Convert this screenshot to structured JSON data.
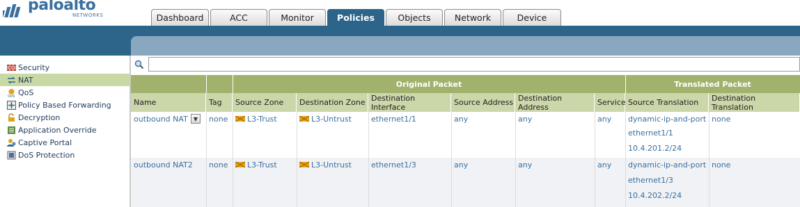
{
  "logo": {
    "name": "paloalto",
    "sub": "NETWORKS"
  },
  "tabs": [
    "Dashboard",
    "ACC",
    "Monitor",
    "Policies",
    "Objects",
    "Network",
    "Device"
  ],
  "active_tab": "Policies",
  "sidebar": {
    "items": [
      {
        "label": "Security",
        "icon": "firewall-icon"
      },
      {
        "label": "NAT",
        "icon": "nat-icon"
      },
      {
        "label": "QoS",
        "icon": "qos-icon"
      },
      {
        "label": "Policy Based Forwarding",
        "icon": "pbf-icon"
      },
      {
        "label": "Decryption",
        "icon": "lock-icon"
      },
      {
        "label": "Application Override",
        "icon": "app-override-icon"
      },
      {
        "label": "Captive Portal",
        "icon": "captive-portal-icon"
      },
      {
        "label": "DoS Protection",
        "icon": "dos-icon"
      }
    ],
    "active": "NAT"
  },
  "search": {
    "value": "",
    "placeholder": ""
  },
  "table": {
    "groups": {
      "original": "Original Packet",
      "translated": "Translated Packet"
    },
    "columns": [
      "Name",
      "Tag",
      "Source Zone",
      "Destination Zone",
      "Destination Interface",
      "Source Address",
      "Destination Address",
      "Service",
      "Source Translation",
      "Destination Translation"
    ],
    "rows": [
      {
        "name": "outbound NAT",
        "tag": "none",
        "source_zone": "L3-Trust",
        "destination_zone": "L3-Untrust",
        "destination_interface": "ethernet1/1",
        "source_address": "any",
        "destination_address": "any",
        "service": "any",
        "source_translation": [
          "dynamic-ip-and-port",
          "ethernet1/1",
          "10.4.201.2/24"
        ],
        "destination_translation": "none"
      },
      {
        "name": "outbound NAT2",
        "tag": "none",
        "source_zone": "L3-Trust",
        "destination_zone": "L3-Untrust",
        "destination_interface": "ethernet1/3",
        "source_address": "any",
        "destination_address": "any",
        "service": "any",
        "source_translation": [
          "dynamic-ip-and-port",
          "ethernet1/3",
          "10.4.202.2/24"
        ],
        "destination_translation": "none"
      }
    ]
  },
  "colors": {
    "brand": "#3a6f9f",
    "nav_bar": "#2d6489",
    "panel": "#8aa7c0",
    "group_header": "#a0b26b",
    "col_header": "#cbd6a9",
    "active_sidebar": "#c9d9a6",
    "link": "#3a6f9f"
  }
}
